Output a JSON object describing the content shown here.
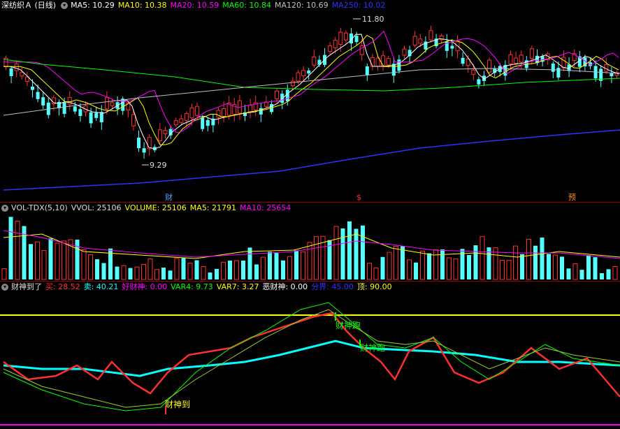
{
  "main_panel": {
    "title": "深纺织Ａ (日线)",
    "ma": [
      {
        "label": "MA5: 10.29",
        "color": "#ffffff"
      },
      {
        "label": "MA10: 10.38",
        "color": "#ffff00"
      },
      {
        "label": "MA20: 10.59",
        "color": "#ff00ff"
      },
      {
        "label": "MA60: 10.84",
        "color": "#00ff00"
      },
      {
        "label": "MA120: 10.69",
        "color": "#c0c0c0"
      },
      {
        "label": "MA250: 10.02",
        "color": "#3030ff"
      }
    ],
    "high_label": "11.80",
    "low_label": "9.29",
    "markers": [
      {
        "text": "财",
        "color": "#4aa3ff"
      },
      {
        "text": "$",
        "color": "#ff3030"
      },
      {
        "text": "预",
        "color": "#ff8c00"
      }
    ]
  },
  "volume_panel": {
    "name": "VOL-TDX(5,10)",
    "items": [
      {
        "label": "VVOL: 25106",
        "color": "#dddddd"
      },
      {
        "label": "VOLUME: 25106",
        "color": "#ffff00"
      },
      {
        "label": "MA5: 21791",
        "color": "#ffff00"
      },
      {
        "label": "MA10: 25654",
        "color": "#ff00ff"
      }
    ]
  },
  "indicator_panel": {
    "name": "财神到了",
    "items": [
      {
        "label": "买: 28.52",
        "color": "#ff3030"
      },
      {
        "label": "卖: 40.21",
        "color": "#00ffff"
      },
      {
        "label": "好财神: 0.00",
        "color": "#ff00ff"
      },
      {
        "label": "VAR4: 9.73",
        "color": "#00ff00"
      },
      {
        "label": "VAR7: 3.27",
        "color": "#ffff00"
      },
      {
        "label": "恶财神: 0.00",
        "color": "#ffffff"
      },
      {
        "label": "分界: 45.00",
        "color": "#3030ff"
      },
      {
        "label": "顶: 90.00",
        "color": "#ffff00"
      }
    ],
    "annotations": [
      {
        "text": "财神到",
        "color": "#ffff00"
      },
      {
        "text": "财神跑",
        "color": "#00ff00"
      },
      {
        "text": "财神跑",
        "color": "#00ff00"
      }
    ]
  },
  "chart_data": {
    "type": "candlestick",
    "series_count": 3,
    "price_high": 11.8,
    "price_low": 9.29,
    "top_line": 90.0,
    "boundary_line": 45.0
  }
}
